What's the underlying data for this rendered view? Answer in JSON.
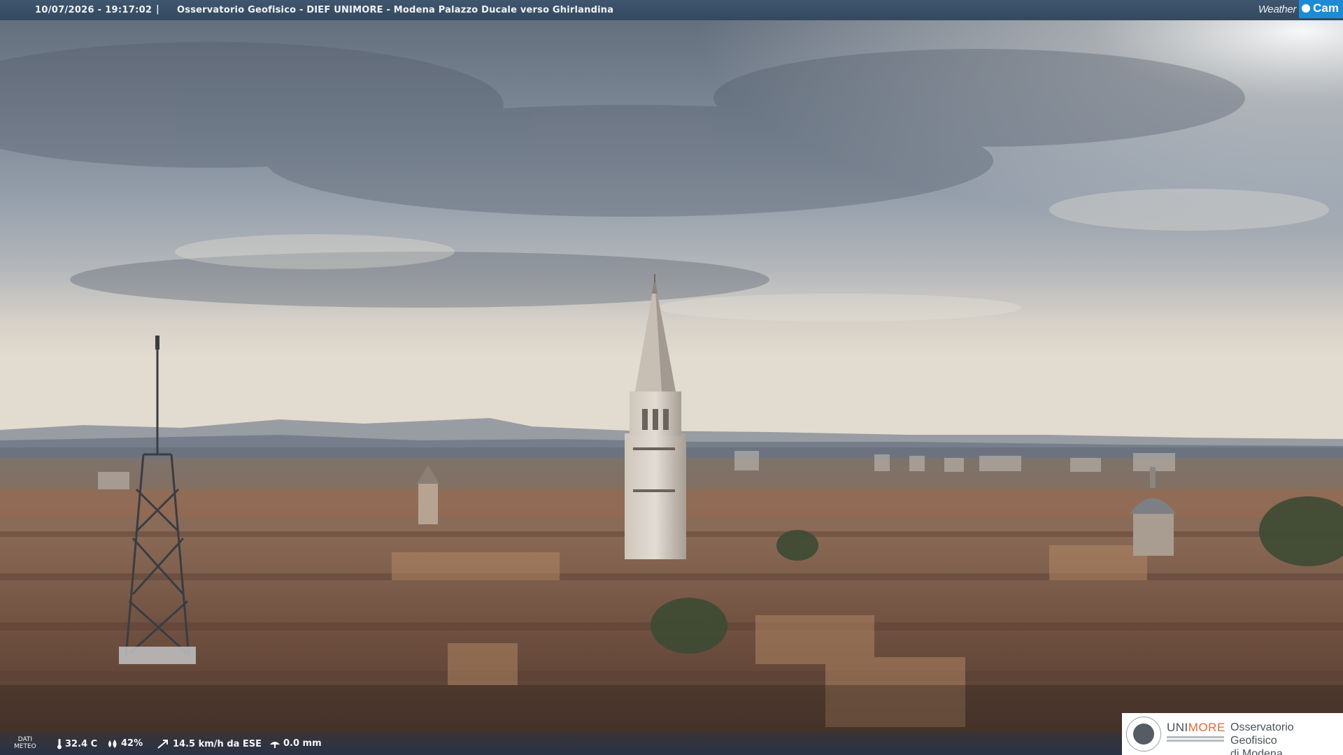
{
  "header": {
    "timestamp": "10/07/2026 - 19:17:02",
    "separator": "|",
    "title": "Osservatorio Geofisico - DIEF UNIMORE - Modena Palazzo Ducale verso Ghirlandina"
  },
  "watermark": {
    "part1": "Weather",
    "part2": "Cam"
  },
  "meteo": {
    "label_line1": "DATI",
    "label_line2": "METEO",
    "temperature": "32.4 C",
    "humidity": "42%",
    "wind": "14.5 km/h da ESE",
    "rain": "0.0 mm"
  },
  "logo": {
    "uni_part1": "UNI",
    "uni_part2": "MORE",
    "observatory_line1": "Osservatorio Geofisico",
    "observatory_line2": "di Modena"
  },
  "colors": {
    "header_bar": "#3f566f",
    "brand_orange": "#e0683a",
    "weathercam_blue": "#1c8bd6"
  }
}
